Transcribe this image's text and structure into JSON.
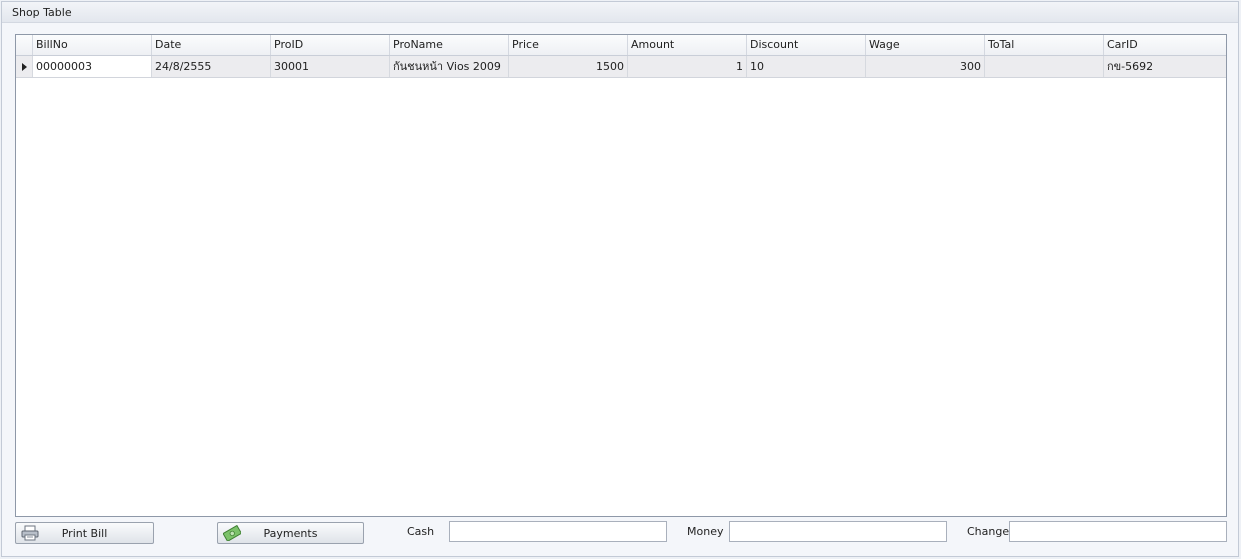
{
  "group": {
    "title": "Shop Table"
  },
  "grid": {
    "columns": [
      "BillNo",
      "Date",
      "ProID",
      "ProName",
      "Price",
      "Amount",
      "Discount",
      "Wage",
      "ToTal",
      "CarID"
    ],
    "rows": [
      {
        "cells": [
          "00000003",
          "24/8/2555",
          "30001",
          "กันชนหน้า Vios 2009",
          "1500",
          "1",
          "10",
          "300",
          "",
          "กข-5692"
        ]
      }
    ]
  },
  "buttons": {
    "print_bill": "Print Bill",
    "payments": "Payments"
  },
  "fields": {
    "cash": {
      "label": "Cash",
      "value": ""
    },
    "money": {
      "label": "Money",
      "value": ""
    },
    "change": {
      "label": "Change",
      "value": ""
    }
  },
  "icons": {
    "print": "printer-icon",
    "payments": "banknote-icon",
    "row_indicator": "row-indicator-arrow-icon"
  }
}
